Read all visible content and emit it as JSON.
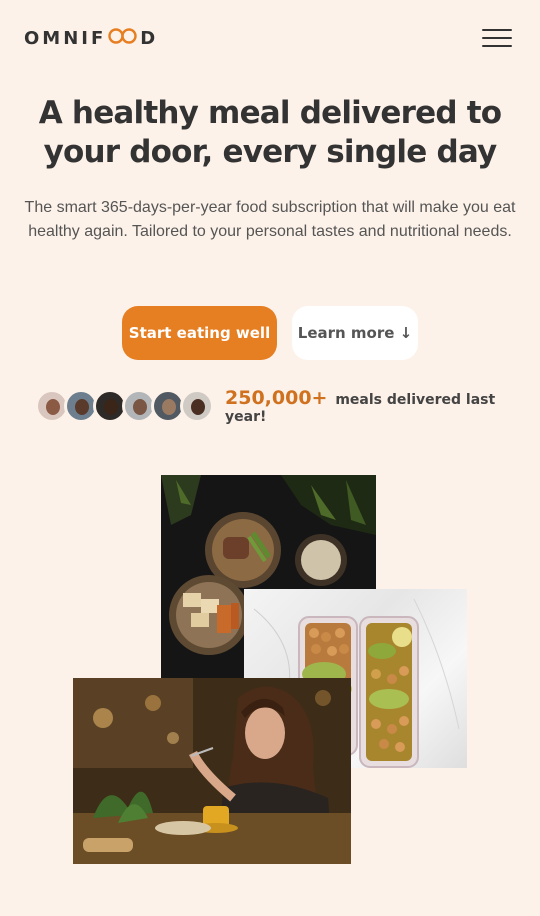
{
  "header": {
    "logo_prefix": "OMNIF",
    "logo_suffix": "D",
    "logo_icon": "infinity-icon",
    "menu_icon": "hamburger-menu-icon"
  },
  "hero": {
    "title": "A healthy meal delivered to your door, every single day",
    "text": "The smart 365-days-per-year food subscription that will make you eat healthy again. Tailored to your personal tastes and nutritional needs.",
    "cta_primary": "Start eating well",
    "cta_secondary": "Learn more ↓"
  },
  "delivered": {
    "count": "250,000+",
    "label": "meals delivered last year!",
    "avatars": [
      "customer-1",
      "customer-2",
      "customer-3",
      "customer-4",
      "customer-5",
      "customer-6"
    ]
  },
  "colors": {
    "background": "#fdf2e9",
    "primary": "#e67e22",
    "accent_text": "#cf711f"
  }
}
